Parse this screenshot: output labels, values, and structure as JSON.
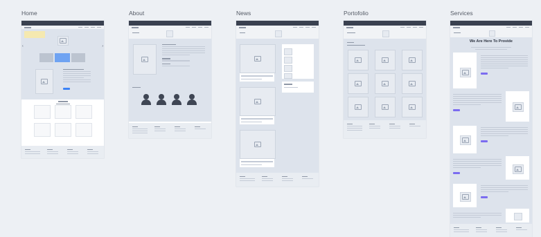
{
  "frames": [
    {
      "title": "Home"
    },
    {
      "title": "About"
    },
    {
      "title": "News"
    },
    {
      "title": "Portofolio"
    },
    {
      "title": "Services"
    }
  ],
  "services": {
    "heading": "We Are Here To Provide"
  },
  "colors": {
    "background": "#edf0f4",
    "header": "#3a4150",
    "accent_blue": "#3b82f6",
    "accent_purple": "#7b6cf0",
    "section": "#dde3ec",
    "placeholder": "#e7ebf1"
  }
}
